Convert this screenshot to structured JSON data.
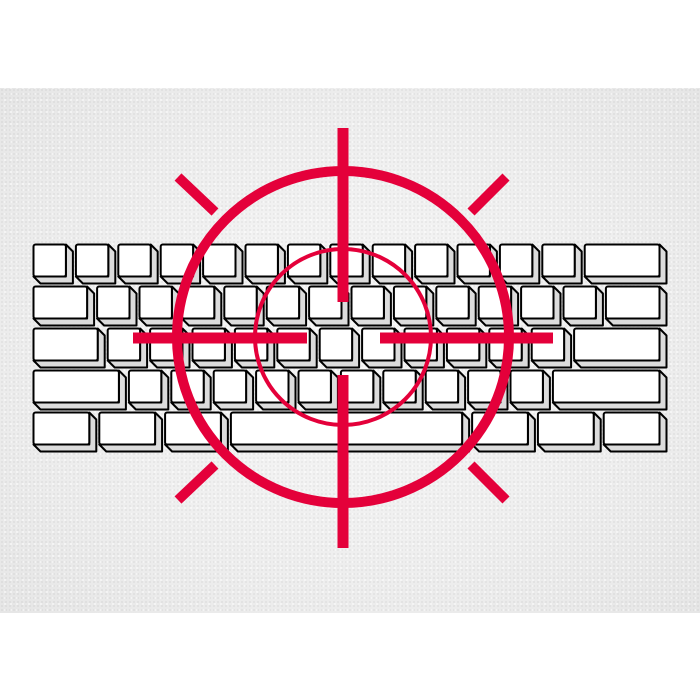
{
  "illustration": {
    "subject": "keyboard-with-crosshair",
    "colors": {
      "background": "#ffffff",
      "band": "#efefef",
      "key_face": "#ffffff",
      "key_side": "#dcdcdc",
      "key_outline": "#000000",
      "crosshair": "#e4003a"
    },
    "keyboard": {
      "rows": [
        [
          1,
          1,
          1,
          1,
          1,
          1,
          1,
          1,
          1,
          1,
          1,
          1,
          1,
          2
        ],
        [
          1.5,
          1,
          1,
          1,
          1,
          1,
          1,
          1,
          1,
          1,
          1,
          1,
          1,
          1.5
        ],
        [
          1.75,
          1,
          1,
          1,
          1,
          1,
          1,
          1,
          1,
          1,
          1,
          1,
          2.25
        ],
        [
          2.25,
          1,
          1,
          1,
          1,
          1,
          1,
          1,
          1,
          1,
          1,
          2.75
        ],
        [
          1.5,
          1.5,
          1.5,
          5.5,
          1.5,
          1.5,
          1.5
        ]
      ]
    }
  }
}
